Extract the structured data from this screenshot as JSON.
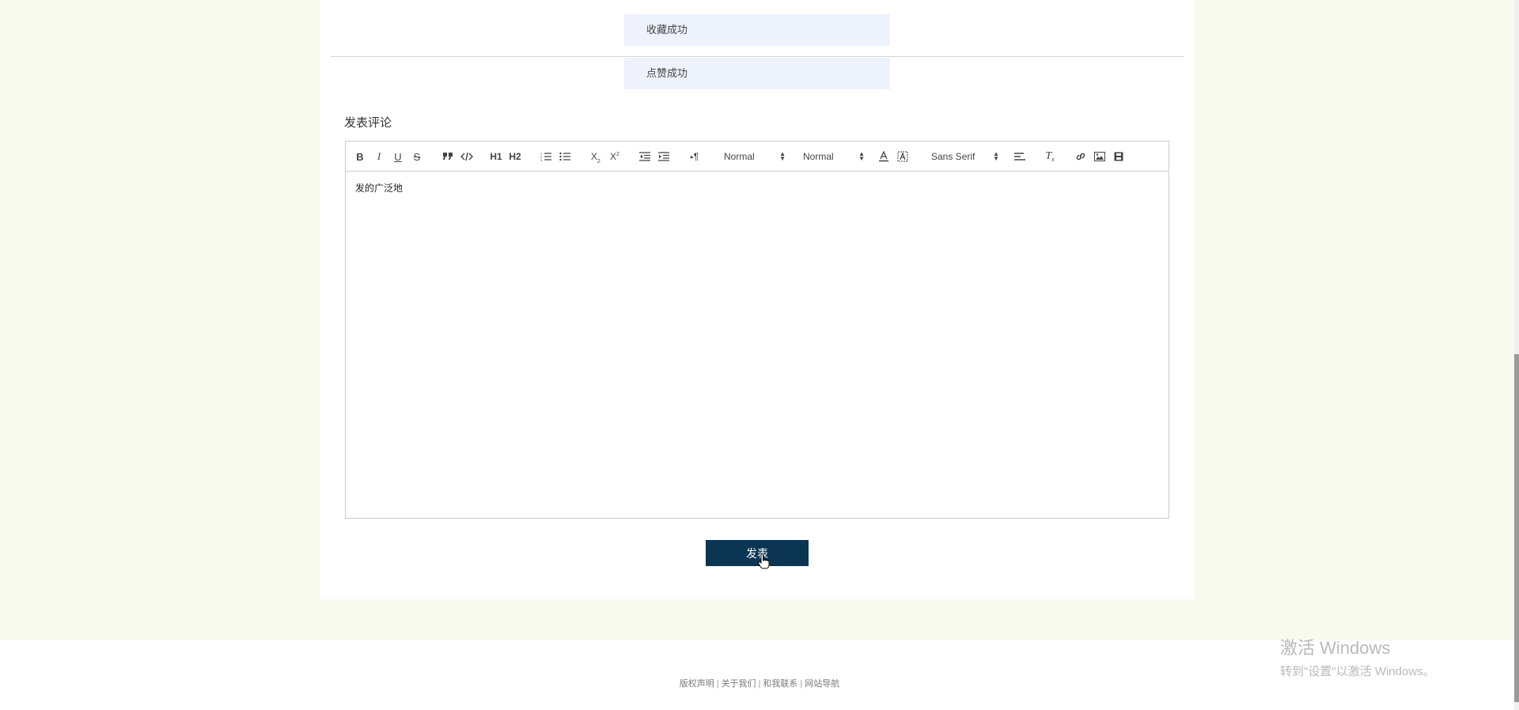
{
  "toasts": {
    "collect": "收藏成功",
    "like": "点赞成功"
  },
  "comment": {
    "title": "发表评论",
    "content": "发的广泛地",
    "submit_label": "发表"
  },
  "toolbar": {
    "buttons": {
      "bold": "B",
      "italic": "I",
      "underline": "U",
      "strike": "S",
      "h1": "H1",
      "h2": "H2",
      "subscript": "X2",
      "superscript": "X2"
    },
    "icons": [
      "bold-icon",
      "italic-icon",
      "underline-icon",
      "strike-icon",
      "blockquote-icon",
      "code-block-icon",
      "header1-icon",
      "header2-icon",
      "ordered-list-icon",
      "bullet-list-icon",
      "subscript-icon",
      "superscript-icon",
      "indent-decrease-icon",
      "indent-increase-icon",
      "rtl-direction-icon",
      "color-icon",
      "background-icon",
      "align-icon",
      "clean-format-icon",
      "link-icon",
      "image-icon",
      "video-icon"
    ],
    "size_picker_1": "Normal",
    "size_picker_2": "Normal",
    "font_picker": "Sans Serif"
  },
  "footer": {
    "copyright": "版权声明",
    "about": "关于我们",
    "contact": "和我联系",
    "nav": "网站导航",
    "separator": "|"
  },
  "watermark": {
    "line1": "激活 Windows",
    "line2": "转到\"设置\"以激活 Windows。"
  },
  "colors": {
    "background": "#f8faef",
    "toast_bg": "#edf2fc",
    "submit_bg": "#0c3554"
  }
}
